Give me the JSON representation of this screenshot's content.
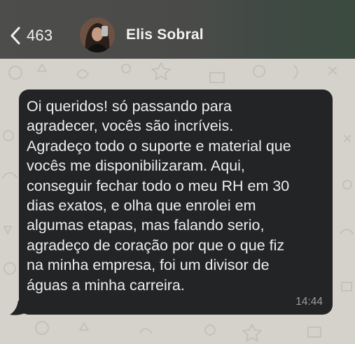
{
  "header": {
    "back_count": "463",
    "contact_name": "Elis Sobral"
  },
  "message": {
    "lines": [
      "Oi queridos! só passando para",
      "agradecer, vocês são incríveis.",
      "Agradeço todo o suporte e material que",
      "vocês me disponibilizaram. Aqui,",
      "conseguir fechar todo o meu RH em 30",
      "dias exatos, e olha que enrolei em",
      "algumas etapas, mas falando serio,",
      "agradeço de coração por que o que fiz",
      "na minha empresa, foi um divisor de",
      "águas a minha carreira."
    ],
    "time": "14:44"
  },
  "colors": {
    "bubble": "#232426",
    "chat_background": "#d5d2cc",
    "header": "#4a4b49"
  },
  "icons": [
    "chevron-left-icon"
  ]
}
